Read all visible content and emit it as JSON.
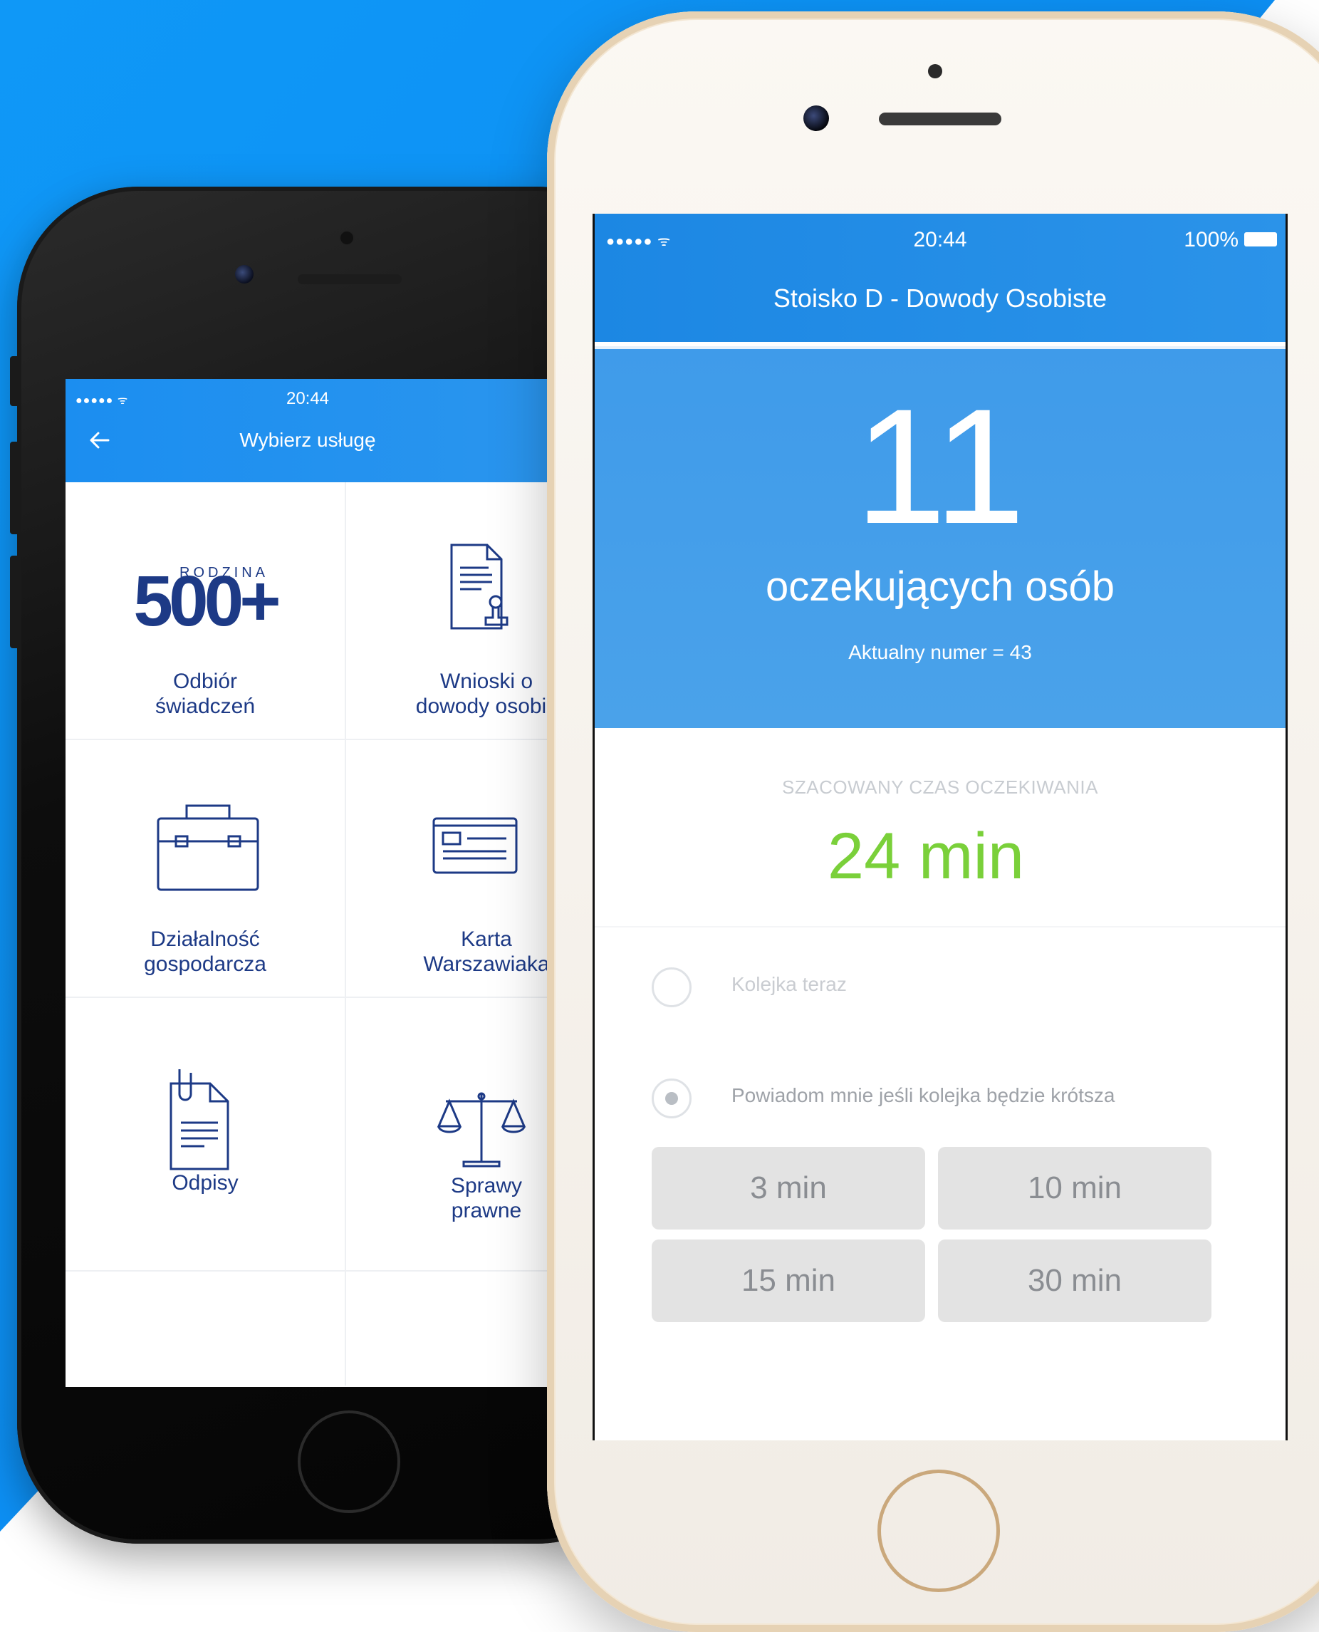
{
  "back_phone": {
    "status": {
      "signal": "●●●●● ᯤ",
      "time": "20:44"
    },
    "header": {
      "back_icon": "arrow-left-icon",
      "title": "Wybierz usługę"
    },
    "tiles": [
      {
        "icon": "rodzina-500-logo",
        "logo_big": "500+",
        "logo_small": "RODZINA",
        "label_line1": "Odbiór",
        "label_line2": "świadczeń"
      },
      {
        "icon": "document-stamp-icon",
        "label_line1": "Wnioski o",
        "label_line2": "dowody osobis"
      },
      {
        "icon": "briefcase-icon",
        "label_line1": "Działalność",
        "label_line2": "gospodarcza"
      },
      {
        "icon": "id-card-icon",
        "label_line1": "Karta",
        "label_line2": "Warszawiaka"
      },
      {
        "icon": "document-clip-icon",
        "label_line1": "Odpisy",
        "label_line2": ""
      },
      {
        "icon": "scales-icon",
        "label_line1": "Sprawy",
        "label_line2": "prawne"
      }
    ]
  },
  "front_phone": {
    "status": {
      "signal": "●●●●● ᯤ",
      "time": "20:44",
      "battery": "100%"
    },
    "header": {
      "title": "Stoisko D - Dowody Osobiste"
    },
    "queue": {
      "count": "11",
      "caption": "oczekujących osób",
      "current_number": "Aktualny numer = 43"
    },
    "estimate": {
      "label": "SZACOWANY CZAS OCZEKIWANIA",
      "value": "24 min"
    },
    "options": [
      {
        "label": "Kolejka teraz",
        "selected": false
      },
      {
        "label": "Powiadom mnie jeśli kolejka będzie krótsza",
        "selected": true
      }
    ],
    "durations": [
      "3 min",
      "10 min",
      "15 min",
      "30 min"
    ]
  },
  "colors": {
    "background_blue": "#0a8ff5",
    "header_blue": "#1c87e3",
    "hero_blue": "#4aa2ea",
    "estimate_green": "#7ad03a",
    "icon_navy": "#1d3a86"
  }
}
